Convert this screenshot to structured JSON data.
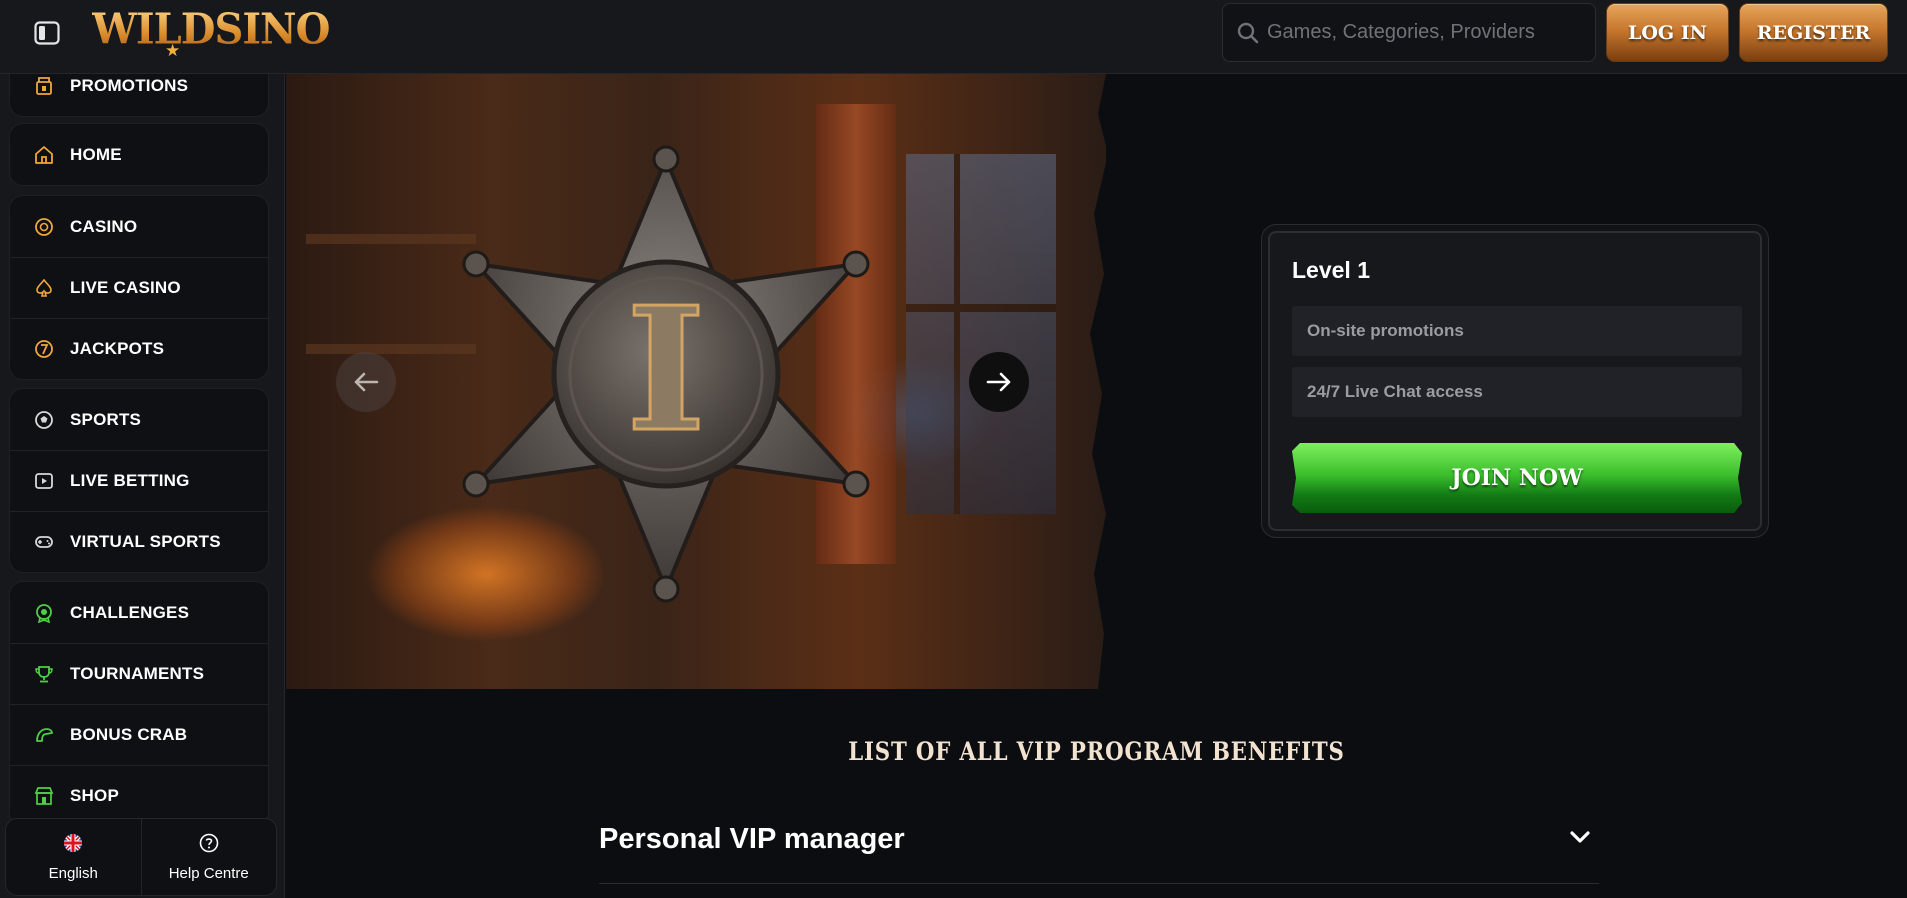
{
  "header": {
    "logo_text": "WILDSINO",
    "search_placeholder": "Games, Categories, Providers",
    "login_label": "LOG IN",
    "register_label": "REGISTER"
  },
  "sidebar": {
    "groups": [
      [
        {
          "label": "PROMOTIONS",
          "icon": "promotions-icon"
        }
      ],
      [
        {
          "label": "HOME",
          "icon": "home-icon"
        }
      ],
      [
        {
          "label": "CASINO",
          "icon": "casino-chip-icon"
        },
        {
          "label": "LIVE CASINO",
          "icon": "spade-icon"
        },
        {
          "label": "JACKPOTS",
          "icon": "jackpot-seven-icon"
        }
      ],
      [
        {
          "label": "SPORTS",
          "icon": "soccer-ball-icon"
        },
        {
          "label": "LIVE BETTING",
          "icon": "live-play-icon"
        },
        {
          "label": "VIRTUAL SPORTS",
          "icon": "gamepad-icon"
        }
      ],
      [
        {
          "label": "CHALLENGES",
          "icon": "challenge-medal-icon"
        },
        {
          "label": "TOURNAMENTS",
          "icon": "trophy-icon"
        },
        {
          "label": "BONUS CRAB",
          "icon": "crab-claw-icon"
        },
        {
          "label": "SHOP",
          "icon": "shop-icon"
        }
      ]
    ],
    "footer": {
      "language_label": "English",
      "help_label": "Help Centre"
    }
  },
  "hero": {
    "level_title": "Level 1",
    "perks": [
      "On-site promotions",
      "24/7 Live Chat access"
    ],
    "join_label": "JOIN NOW",
    "badge_numeral": "I"
  },
  "benefits": {
    "title": "LIST OF ALL VIP PROGRAM BENEFITS",
    "first_item": "Personal VIP manager"
  },
  "colors": {
    "accent_gold": "#d98b2a",
    "join_green": "#3cbf2d",
    "bg_dark": "#0c0d10",
    "panel": "#17181c"
  }
}
